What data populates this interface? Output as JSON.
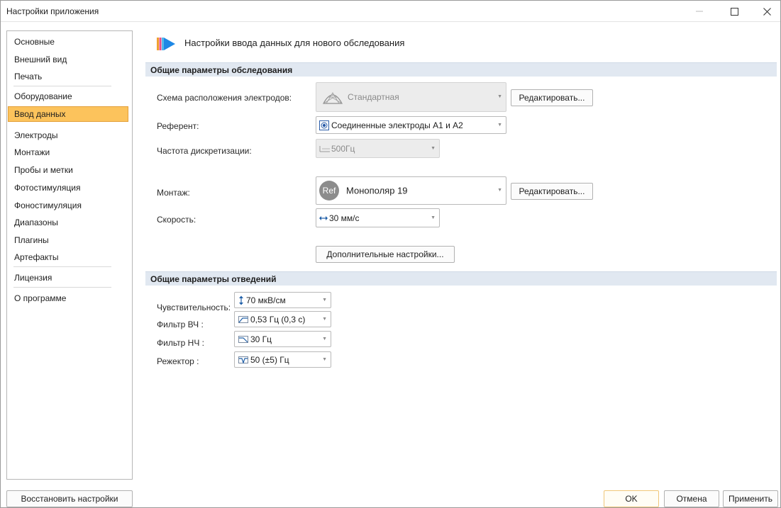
{
  "window": {
    "title": "Настройки приложения"
  },
  "sidebar": {
    "items": [
      {
        "label": "Основные"
      },
      {
        "label": "Внешний вид"
      },
      {
        "label": "Печать"
      },
      {
        "label": "Оборудование"
      },
      {
        "label": "Ввод данных"
      },
      {
        "label": "Электроды"
      },
      {
        "label": "Монтажи"
      },
      {
        "label": "Пробы и метки"
      },
      {
        "label": "Фотостимуляция"
      },
      {
        "label": "Фоностимуляция"
      },
      {
        "label": "Диапазоны"
      },
      {
        "label": "Плагины"
      },
      {
        "label": "Артефакты"
      },
      {
        "label": "Лицензия"
      },
      {
        "label": "О программе"
      }
    ],
    "active": "Ввод данных",
    "restore_button": "Восстановить настройки"
  },
  "main": {
    "header_title": "Настройки ввода данных для нового обследования",
    "section1": {
      "title": "Общие параметры обследования",
      "electrode_layout_label": "Схема расположения электродов:",
      "electrode_layout_value": "Стандартная",
      "edit_label": "Редактировать...",
      "referent_label": "Референт:",
      "referent_value": "Соединенные электроды А1 и А2",
      "sample_rate_label": "Частота дискретизации:",
      "sample_rate_value": "500Гц",
      "montage_label": "Монтаж:",
      "montage_badge": "Ref",
      "montage_value": "Монополяр 19",
      "speed_label": "Скорость:",
      "speed_value": "30 мм/с",
      "advanced_button": "Дополнительные настройки..."
    },
    "section2": {
      "title": "Общие параметры отведений",
      "sensitivity_label": "Чувствительность:",
      "sensitivity_value": "70 мкВ/см",
      "hf_filter_label": "Фильтр ВЧ :",
      "hf_filter_value": "0,53 Гц (0,3 с)",
      "lf_filter_label": "Фильтр НЧ :",
      "lf_filter_value": "30 Гц",
      "notch_label": "Режектор :",
      "notch_value": "50 (±5) Гц"
    }
  },
  "footer": {
    "ok": "OK",
    "cancel": "Отмена",
    "apply": "Применить"
  },
  "colors": {
    "active_item": "#fcc35c",
    "group_bar": "#e1e8f1",
    "header_icon": "#1e88e5"
  }
}
